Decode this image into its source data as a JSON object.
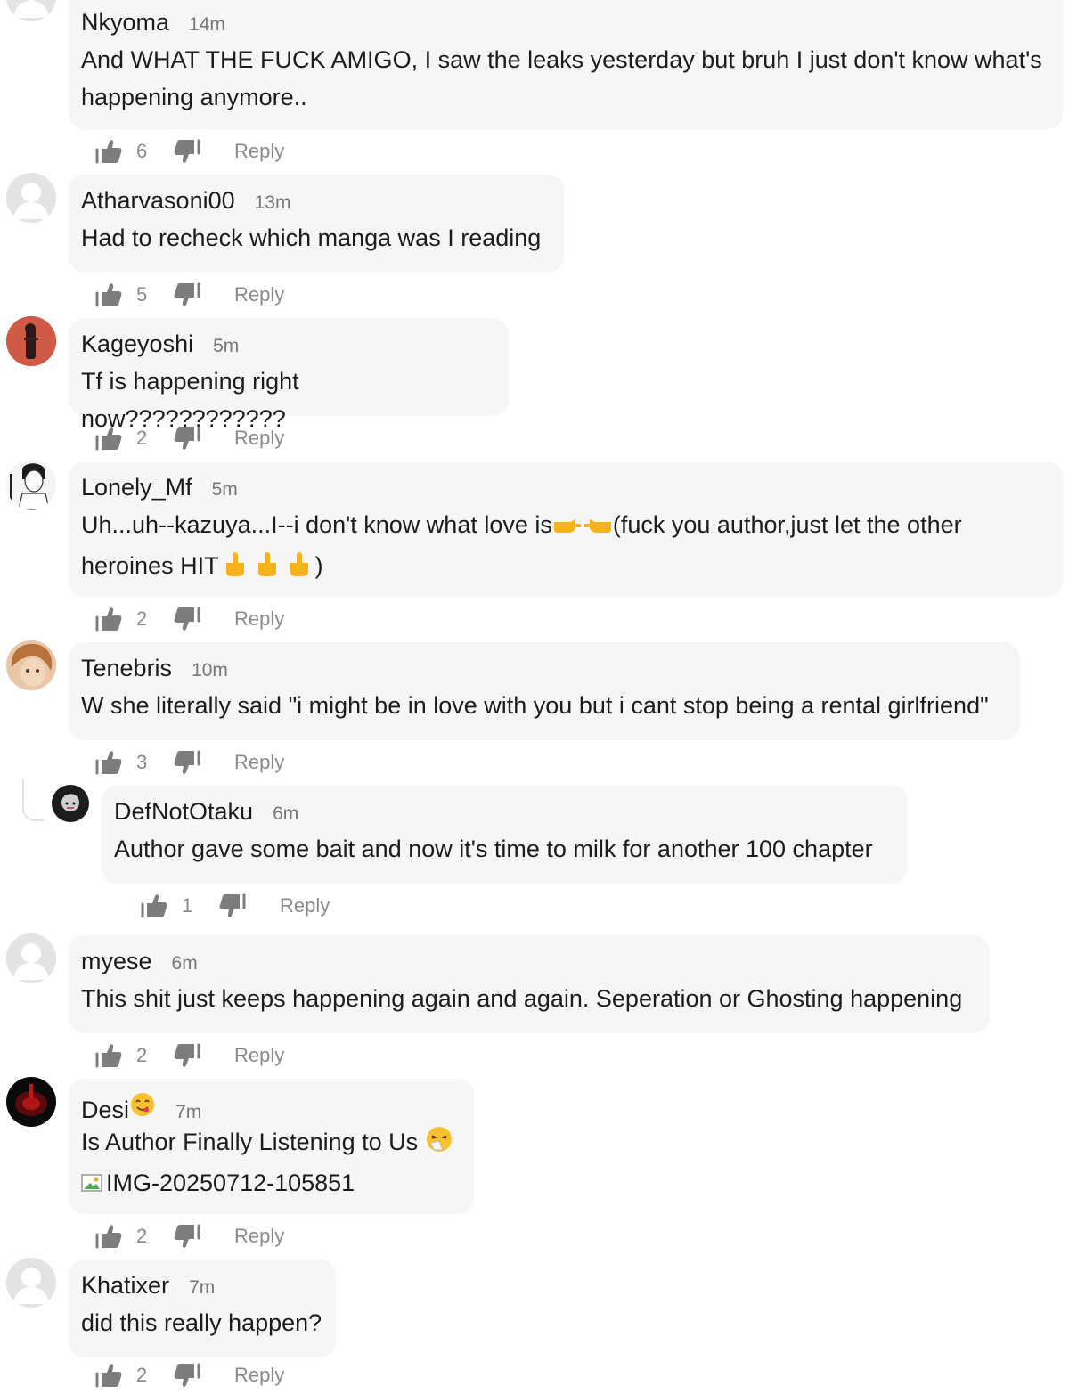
{
  "comments": [
    {
      "user": "Nkyoma",
      "time": "14m",
      "lines": [
        "And WHAT THE FUCK AMIGO, I saw the leaks yesterday but bruh I just don't know what's",
        "happening anymore.."
      ],
      "likes": "6",
      "reply": "Reply"
    },
    {
      "user": "Atharvasoni00",
      "time": "13m",
      "lines": [
        "Had to recheck which manga was I reading"
      ],
      "likes": "5",
      "reply": "Reply"
    },
    {
      "user": "Kageyoshi",
      "time": "5m",
      "lines": [
        "Tf is happening right now????????????"
      ],
      "likes": "2",
      "reply": "Reply"
    },
    {
      "user": "Lonely_Mf",
      "time": "5m",
      "line1a": "Uh...uh--kazuya...I--i don't know what love is",
      "line1b": "(fuck you author,just let the other",
      "line2a": "heroines HIT",
      "line2b": ")",
      "likes": "2",
      "reply": "Reply"
    },
    {
      "user": "Tenebris",
      "time": "10m",
      "lines": [
        "W she literally said \"i might be in love with you but i cant stop being a rental girlfriend\""
      ],
      "likes": "3",
      "reply": "Reply"
    },
    {
      "user": "DefNotOtaku",
      "time": "6m",
      "lines": [
        "Author gave some bait and now it's time to milk for another 100 chapter"
      ],
      "likes": "1",
      "reply": "Reply"
    },
    {
      "user": "myese",
      "time": "6m",
      "lines": [
        "This shit just keeps happening again and again. Seperation or Ghosting happening"
      ],
      "likes": "2",
      "reply": "Reply"
    },
    {
      "user": "Desi",
      "time": "7m",
      "line1": "Is Author Finally Listening to Us",
      "image_alt": "IMG-20250712-105851",
      "likes": "2",
      "reply": "Reply"
    },
    {
      "user": "Khatixer",
      "time": "7m",
      "lines": [
        "did this really happen?"
      ],
      "likes": "2",
      "reply": "Reply"
    }
  ],
  "icons": {
    "like": "thumbs-up-icon",
    "dislike": "thumbs-down-icon",
    "avatar_default": "default-user-avatar"
  },
  "colors": {
    "bubble": "#f6f6f6",
    "muted": "#8a8a8a",
    "text": "#1c1c1c"
  }
}
